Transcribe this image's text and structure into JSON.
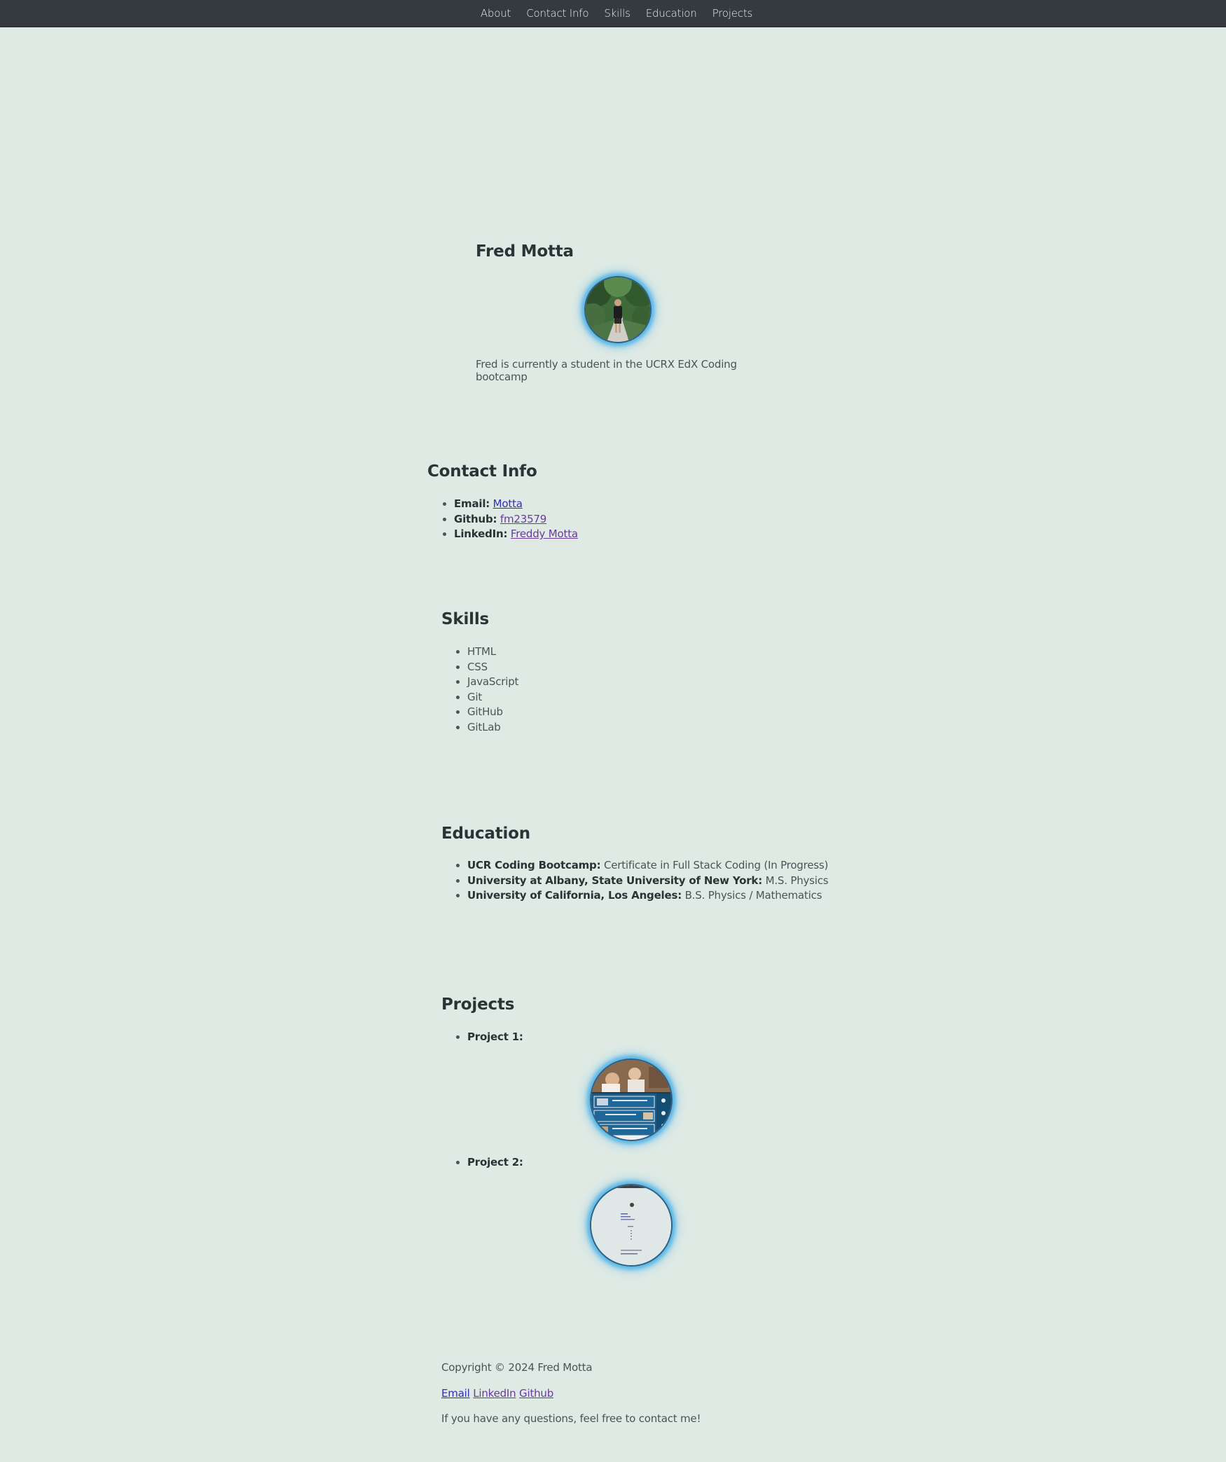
{
  "nav": {
    "items": [
      {
        "label": "About"
      },
      {
        "label": "Contact Info"
      },
      {
        "label": "Skills"
      },
      {
        "label": "Education"
      },
      {
        "label": "Projects"
      }
    ]
  },
  "about": {
    "name": "Fred Motta",
    "bio": "Fred is currently a student in the UCRX EdX Coding bootcamp"
  },
  "contact": {
    "heading": "Contact Info",
    "items": [
      {
        "label": "Email:",
        "link": "Motta"
      },
      {
        "label": "Github:",
        "link": "fm23579"
      },
      {
        "label": "LinkedIn:",
        "link": "Freddy Motta"
      }
    ]
  },
  "skills": {
    "heading": "Skills",
    "items": [
      "HTML",
      "CSS",
      "JavaScript",
      "Git",
      "GitHub",
      "GitLab"
    ]
  },
  "education": {
    "heading": "Education",
    "items": [
      {
        "school": "UCR Coding Bootcamp:",
        "degree": "Certificate in Full Stack Coding (In Progress)"
      },
      {
        "school": "University at Albany, State University of New York:",
        "degree": "M.S. Physics"
      },
      {
        "school": "University of California, Los Angeles:",
        "degree": "B.S. Physics / Mathematics"
      }
    ]
  },
  "projects": {
    "heading": "Projects",
    "items": [
      {
        "label": "Project 1:"
      },
      {
        "label": "Project 2:"
      }
    ]
  },
  "footer": {
    "copyright": "Copyright © 2024 Fred Motta",
    "links": [
      "Email",
      "LinkedIn",
      "Github"
    ],
    "message": "If you have any questions, feel free to contact me!"
  },
  "colors": {
    "background": "#dfeae5",
    "navbar": "#343a40",
    "link": "#2f2fb0",
    "visited_link": "#6a3a9a",
    "glow": "#58b6e8"
  }
}
